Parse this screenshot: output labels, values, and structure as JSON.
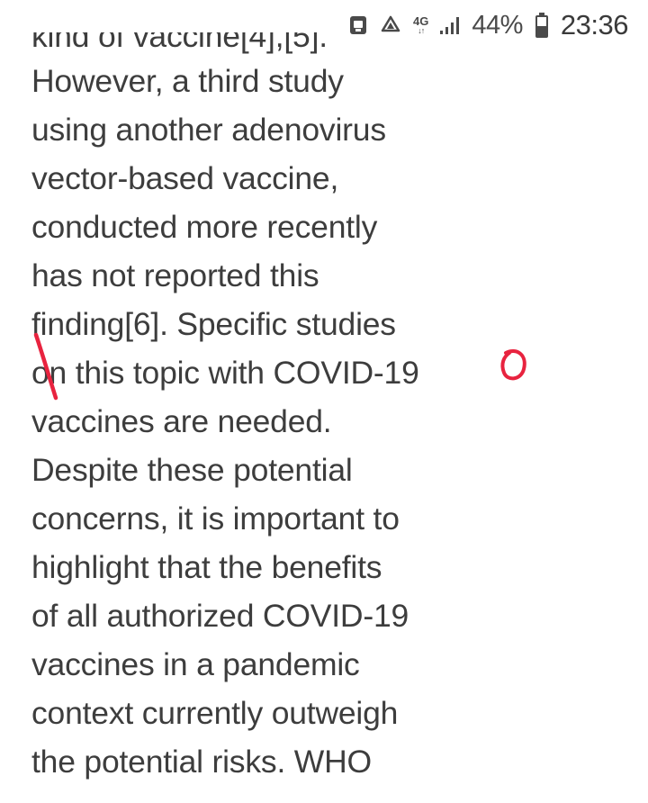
{
  "status_bar": {
    "network_type": "4G",
    "battery_percent": "44%",
    "time": "23:36",
    "icons": [
      "notification-app-icon",
      "recycling-icon",
      "network-data-arrows-icon",
      "signal-strength-icon",
      "battery-icon"
    ]
  },
  "article": {
    "lines": [
      "kind of vaccine[4],[5].",
      "However, a third study",
      "using another adenovirus",
      "vector-based vaccine,",
      "conducted more recently",
      "has not reported this",
      "finding[6]. Specific studies",
      "on this topic with COVID-19",
      "vaccines are needed.",
      "Despite these potential",
      "concerns, it is important to",
      "highlight that the benefits",
      "of all authorized COVID-19",
      "vaccines in a pandemic",
      "context currently outweigh",
      "the potential risks. WHO"
    ]
  },
  "annotations": {
    "ink_color": "#e8233f"
  }
}
